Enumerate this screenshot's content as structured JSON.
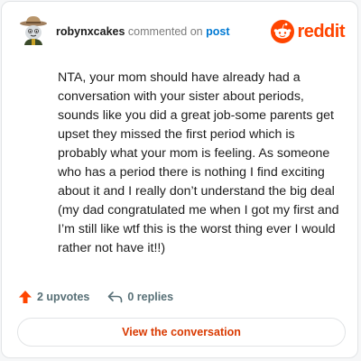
{
  "header": {
    "username": "robynxcakes",
    "verb": "commented on",
    "post_link": "post",
    "logo_text": "reddit",
    "avatar_icon": "avatar-cowboy-icon",
    "logo_icon": "reddit-alien-icon"
  },
  "comment": {
    "body": "NTA, your mom should have already had a conversation with your sister about periods, sounds like you did a great job-some parents get upset they missed the first period which is probably what your mom is feeling. As someone who has a period there is nothing I find exciting about it and I really don’t understand the big deal (my dad congratulated me when I got my first and I’m still like wtf this is the worst thing ever I would rather not have it!!)"
  },
  "actions": {
    "upvotes": "2 upvotes",
    "replies": "0 replies",
    "upvote_icon": "upvote-arrow-icon",
    "reply_icon": "reply-arrow-icon"
  },
  "cta": {
    "label": "View the conversation"
  },
  "colors": {
    "accent": "#ff4500",
    "link": "#0079d3",
    "cta_text": "#d93900"
  }
}
